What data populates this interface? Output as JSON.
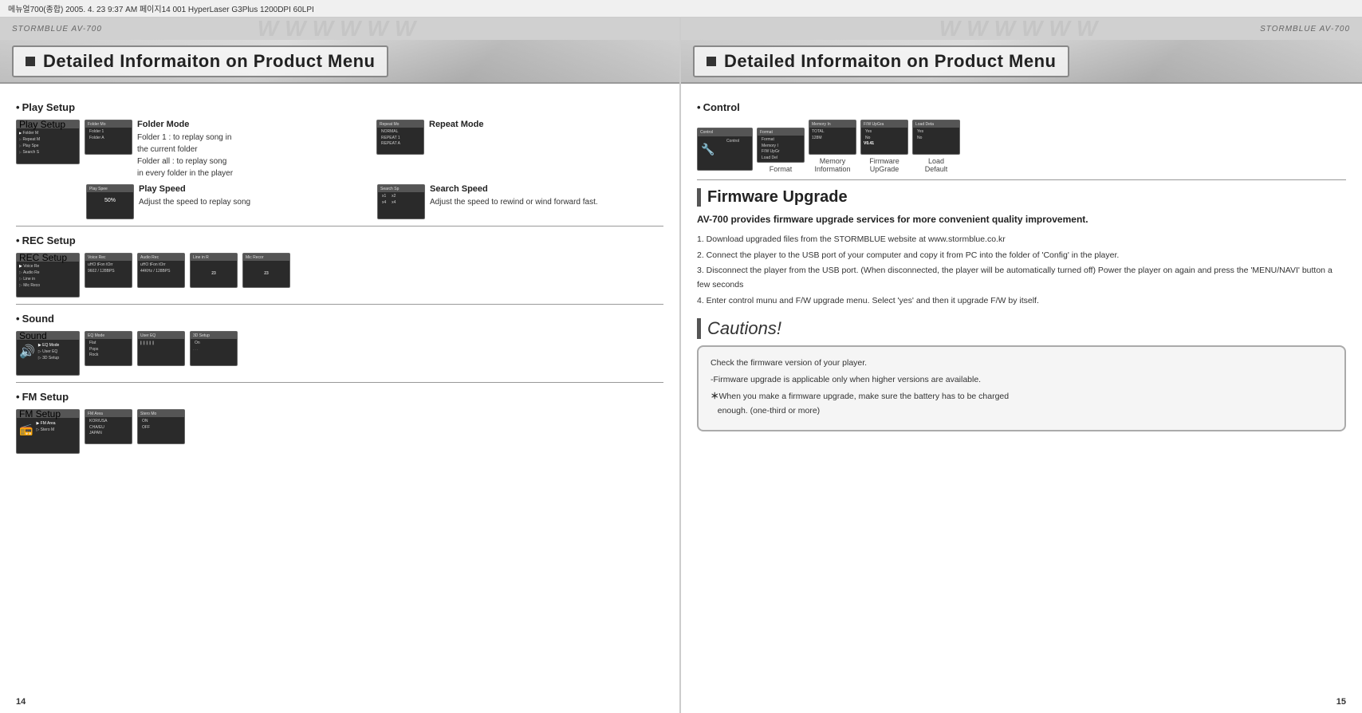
{
  "printBar": {
    "text": "메뉴얼700(종합)  2005. 4. 23  9:37 AM  페이지14   001 HyperLaser G3Plus 1200DPI 60LPI"
  },
  "header": {
    "brandLeft": "STORMBLUE AV-700",
    "brandRight": "STORMBLUE AV-700",
    "watermark": "WWWW..."
  },
  "titleBanner": {
    "text": "Detailed Informaiton on Product Menu"
  },
  "leftPage": {
    "pageNumber": "14",
    "sections": {
      "playSetup": {
        "header": "Play Setup",
        "folderMode": {
          "title": "Folder Mode",
          "lines": [
            "Folder 1 : to replay song in",
            "the current folder",
            "Folder all : to replay song",
            "in every folder in the player"
          ]
        },
        "repeatMode": {
          "title": "Repeat Mode"
        },
        "playSpeed": {
          "title": "Play Speed",
          "desc": "Adjust the speed to replay song"
        },
        "searchSpeed": {
          "title": "Search Speed",
          "desc": "Adjust the speed to rewind or wind forward fast."
        }
      },
      "recSetup": {
        "header": "REC Setup"
      },
      "sound": {
        "header": "Sound"
      },
      "fmSetup": {
        "header": "FM Setup"
      }
    }
  },
  "rightPage": {
    "pageNumber": "15",
    "control": {
      "header": "Control",
      "screens": [
        {
          "label": "Control"
        },
        {
          "label": "Format"
        },
        {
          "label": "Memory\nInformation"
        },
        {
          "label": "Firmware\nUpGrade"
        },
        {
          "label": "Load\nDefault"
        }
      ]
    },
    "firmwareUpgrade": {
      "title": "Firmware Upgrade",
      "subtitle": "AV-700 provides firmware upgrade services for more convenient quality improvement.",
      "steps": [
        "1. Download upgraded files from the STORMBLUE website at www.stormblue.co.kr",
        "2. Connect the player to the USB port of your computer and copy it from PC into the folder of 'Config' in the player.",
        "3. Disconnect the player from the USB port. (When disconnected, the player will be automatically turned off) Power the player on again and press the 'MENU/NAVI' button a few seconds",
        "4. Enter control munu and F/W upgrade menu. Select 'yes' and then it upgrade F/W by itself."
      ]
    },
    "cautions": {
      "title": "Cautions!",
      "lines": [
        "Check the firmware version of your player.",
        "-Firmware upgrade is applicable only when higher versions are available.",
        "＊When you make a firmware upgrade, make sure the battery has to be charged enough. (one-third or more)"
      ]
    }
  }
}
